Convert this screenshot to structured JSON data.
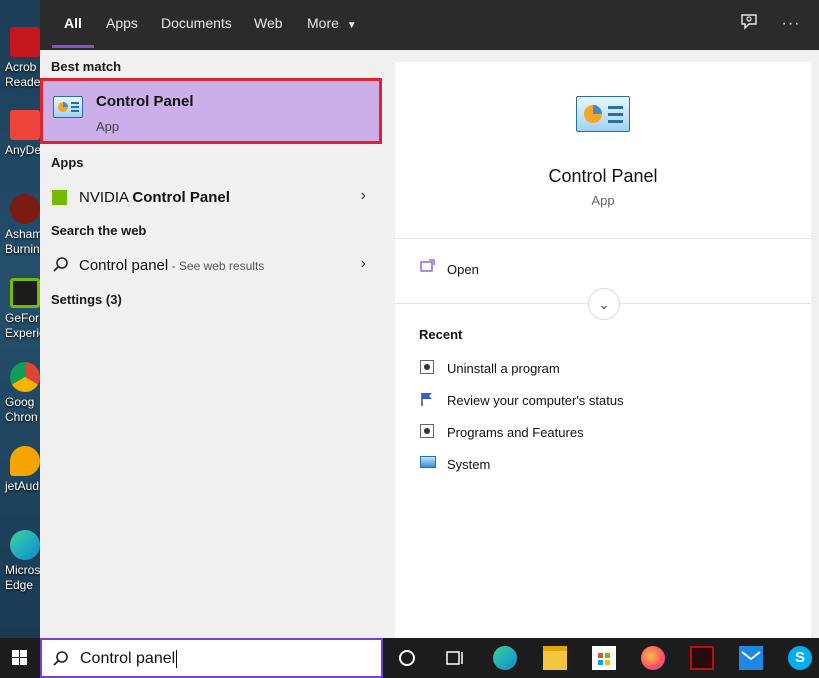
{
  "desktop": {
    "icons": [
      {
        "label": "Acrob\nReader",
        "icon": "acrobat-reader-icon",
        "color": "#c4161c"
      },
      {
        "label": "AnyDe",
        "icon": "anydesk-icon",
        "color": "#ef443b"
      },
      {
        "label": "Ashamp\nBurning",
        "icon": "ashampoo-burning-icon",
        "color": "#7a1c12"
      },
      {
        "label": "GeFor\nExperie",
        "icon": "geforce-experience-icon",
        "color": "#76b900"
      },
      {
        "label": "Goog\nChron",
        "icon": "google-chrome-icon",
        "color": "#db4437"
      },
      {
        "label": "jetAud",
        "icon": "jetaudio-icon",
        "color": "#f6a400"
      },
      {
        "label": "Micros\nEdge",
        "icon": "microsoft-edge-icon",
        "color": "#0c8ad3"
      }
    ]
  },
  "tabs": [
    {
      "label": "All"
    },
    {
      "label": "Apps"
    },
    {
      "label": "Documents"
    },
    {
      "label": "Web"
    },
    {
      "label": "More"
    }
  ],
  "left": {
    "best_match_header": "Best match",
    "best_match": {
      "title": "Control Panel",
      "subtitle": "App"
    },
    "apps_header": "Apps",
    "apps_item": {
      "prefix": "NVIDIA ",
      "bold": "Control Panel"
    },
    "web_header": "Search the web",
    "web_item": {
      "query": "Control panel",
      "suffix": " - See web results"
    },
    "settings_header": "Settings (3)"
  },
  "right": {
    "title": "Control Panel",
    "subtitle": "App",
    "open_label": "Open",
    "recent_header": "Recent",
    "recent": [
      {
        "label": "Uninstall a program",
        "icon": "programs-icon"
      },
      {
        "label": "Review your computer's status",
        "icon": "flag-icon"
      },
      {
        "label": "Programs and Features",
        "icon": "programs-icon"
      },
      {
        "label": "System",
        "icon": "system-icon"
      }
    ]
  },
  "search": {
    "value": "Control panel"
  },
  "colors": {
    "accent": "#8a4fd1",
    "highlight": "#ccaee8",
    "highlight_border": "#e0242f"
  }
}
